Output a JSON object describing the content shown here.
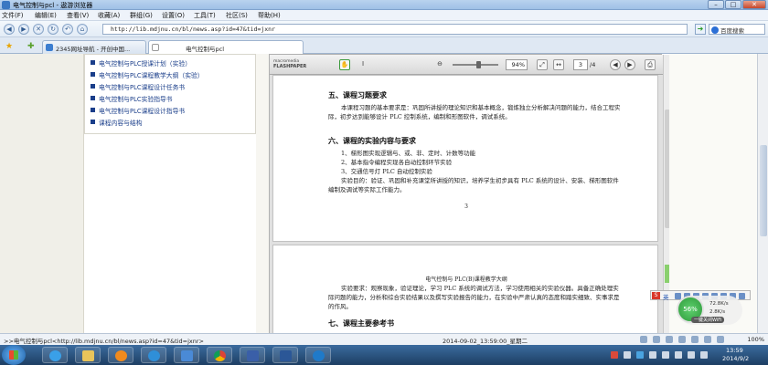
{
  "window": {
    "title": "电气控制与pcl - 遨游浏览器"
  },
  "menu": [
    "文件(F)",
    "编辑(E)",
    "查看(V)",
    "收藏(A)",
    "群组(G)",
    "设置(O)",
    "工具(T)",
    "社区(S)",
    "帮助(H)"
  ],
  "address": {
    "url": "http://lib.mdjnu.cn/bl/news.asp?id=47&tid=jxnr"
  },
  "search": {
    "placeholder": "百度搜索"
  },
  "tabs": [
    {
      "label": "2345网址导航 - 开创中国..."
    },
    {
      "label": "电气控制与pcl"
    }
  ],
  "course_links": [
    "电气控制与PLC授课计划（实验）",
    "电气控制与PLC课程教学大纲（实验）",
    "电气控制与PLC课程设计任务书",
    "电气控制与PLC实验指导书",
    "电气控制与PLC课程设计指导书",
    "课程内容与结构"
  ],
  "viewer": {
    "logo_line1": "macromedia",
    "logo_line2": "FLASHPAPER",
    "zoom": "94%",
    "page_current": "3",
    "page_total": "/4"
  },
  "document": {
    "page1": {
      "h5": "五、课程习题要求",
      "p5": "本课程习题的基本要求是：巩固所讲授的理论知识和基本概念，锻炼独立分析解决问题的能力，结合工程实际，初步达到能够设计 PLC 控制系统，编制和形图软件，调试系统。",
      "h6": "六、课程的实验内容与要求",
      "items": [
        "1、梯形图实现逻辑与、或、非、定时、计数等功能",
        "2、基本指令编程实现各自动控制环节实验",
        "3、交通信号灯 PLC 自动控制实验"
      ],
      "p6": "实验目的：验证、巩固和补充课堂所讲授的知识，培养学生初步具有 PLC 系统的设计、安装、梯形图软件编制及调试等实际工作能力。",
      "page_number": "3"
    },
    "page2": {
      "header": "电气控制与 PLC(B)课程教学大纲",
      "p": "实验要求：观察现象，验证理论，学习 PLC 系统的调试方法，学习使用相关的实验仪器。具备正确处理实际问题的能力，分析和综合实验结果以及撰写实验报告的能力，在实验中严肃认真的态度和踏实细致、实事求是的作风。",
      "h7": "七、课程主要参考书"
    }
  },
  "ime": {
    "badge": "S",
    "lang": "英"
  },
  "network": {
    "percent": "56%",
    "up": "72.8K/s",
    "down": "2.8K/s",
    "caption": "一键关闭WiFi"
  },
  "status": {
    "link": ">>电气控制与pcl<http://lib.mdjnu.cn/bl/news.asp?id=47&tid=jxnr>",
    "datetime": "2014-09-02_13:59:00_星期二",
    "zoom": "100%"
  },
  "clock": {
    "time": "13:59",
    "date": "2014/9/2"
  }
}
